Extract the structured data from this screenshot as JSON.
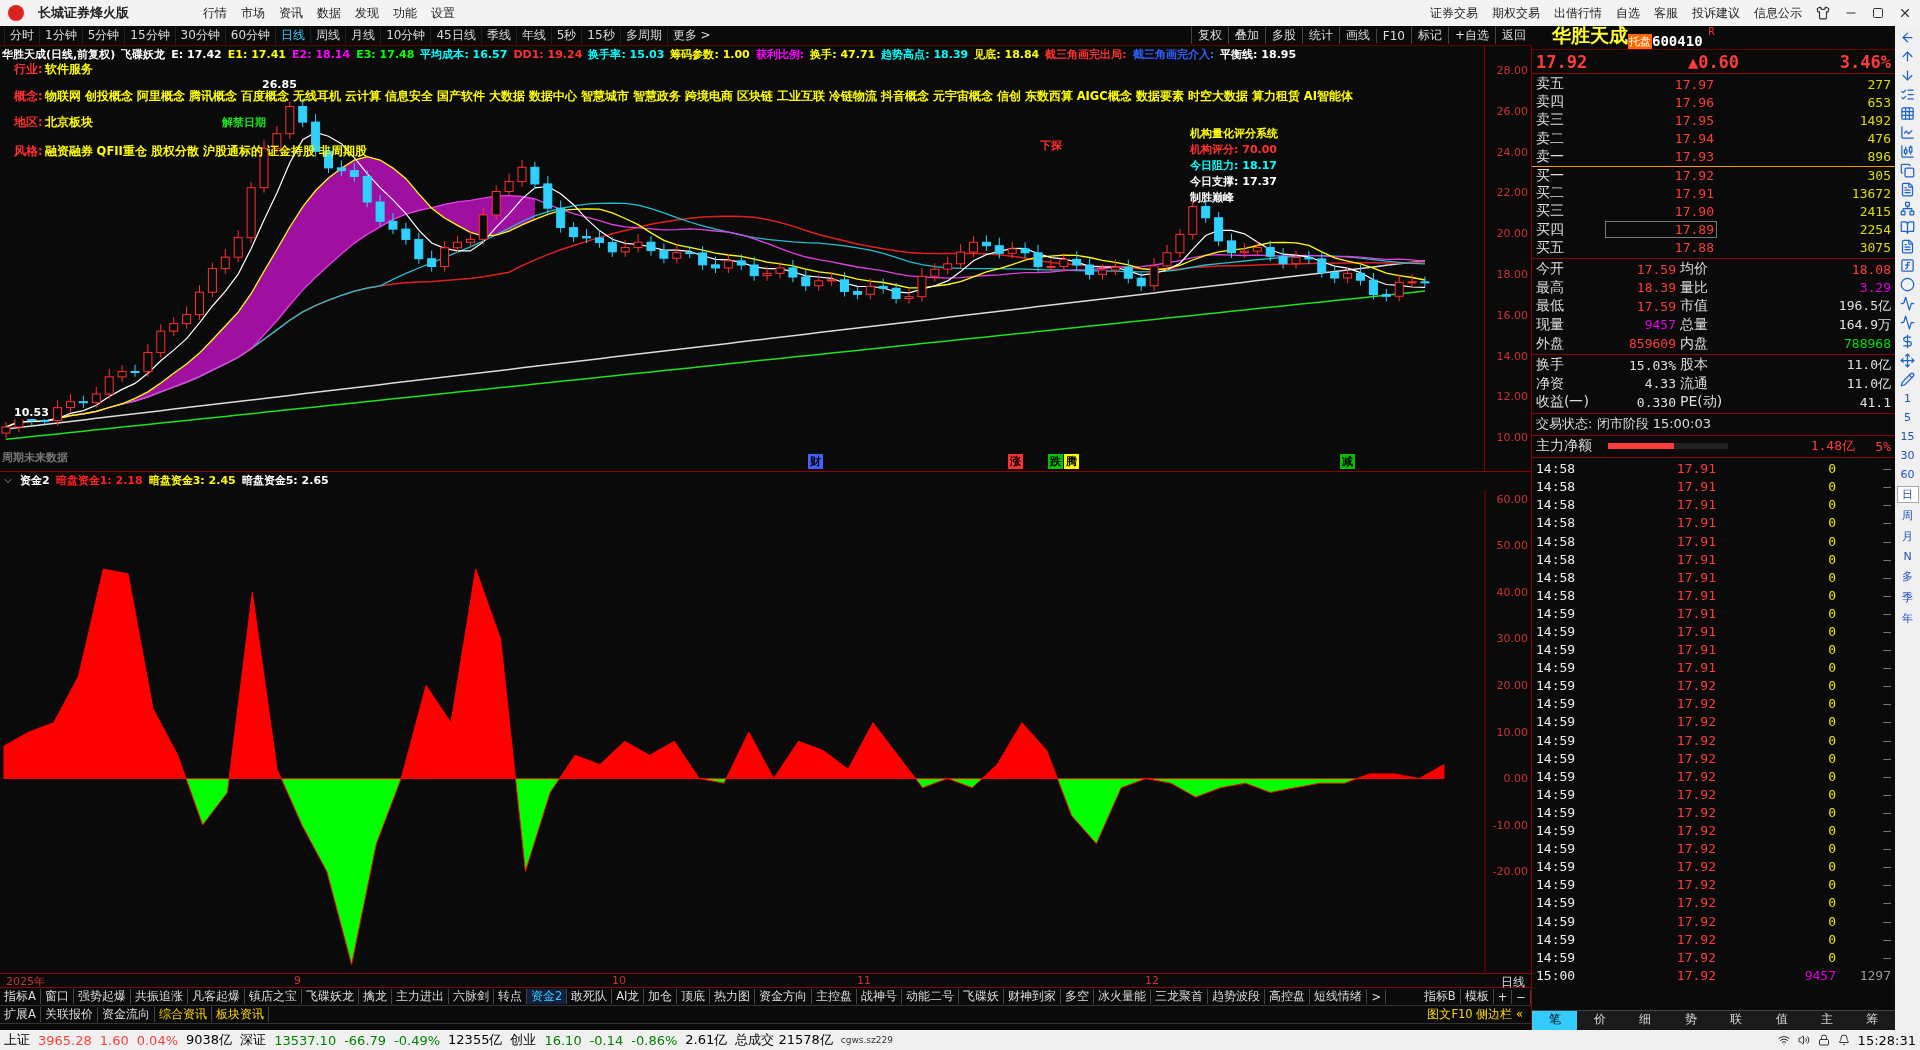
{
  "app": {
    "title": "长城证券烽火版",
    "menu": [
      "行情",
      "市场",
      "资讯",
      "数据",
      "发现",
      "功能",
      "设置"
    ],
    "links": [
      "证券交易",
      "期权交易",
      "出借行情",
      "自选",
      "客服",
      "投诉建议",
      "信息公示"
    ]
  },
  "periods": [
    {
      "label": "分时",
      "selected": false
    },
    {
      "label": "1分钟",
      "selected": false
    },
    {
      "label": "5分钟",
      "selected": false
    },
    {
      "label": "15分钟",
      "selected": false
    },
    {
      "label": "30分钟",
      "selected": false
    },
    {
      "label": "60分钟",
      "selected": false
    },
    {
      "label": "日线",
      "selected": true
    },
    {
      "label": "周线",
      "selected": false
    },
    {
      "label": "月线",
      "selected": false
    },
    {
      "label": "10分钟",
      "selected": false
    },
    {
      "label": "45日线",
      "selected": false
    },
    {
      "label": "季线",
      "selected": false
    },
    {
      "label": "年线",
      "selected": false
    },
    {
      "label": "5秒",
      "selected": false
    },
    {
      "label": "15秒",
      "selected": false
    },
    {
      "label": "多周期",
      "selected": false
    },
    {
      "label": "更多 >",
      "selected": false
    }
  ],
  "chart_tools": [
    "复权",
    "叠加",
    "多股",
    "统计",
    "画线",
    "F10",
    "标记",
    "+自选",
    "返回"
  ],
  "legend": [
    {
      "text": "华胜天成(日线,前复权)",
      "color": "#ffffff"
    },
    {
      "text": "飞碟妖龙",
      "color": "#ffffff"
    },
    {
      "text": "E: 17.42",
      "color": "#ffffff"
    },
    {
      "text": "E1: 17.41",
      "color": "#ffff00"
    },
    {
      "text": "E2: 18.14",
      "color": "#ff00ff"
    },
    {
      "text": "E3: 17.48",
      "color": "#00ff00"
    },
    {
      "text": "平均成本: 16.57",
      "color": "#00ffff"
    },
    {
      "text": "DD1: 19.24",
      "color": "#ff3030"
    },
    {
      "text": "换手率: 15.03",
      "color": "#00ffff"
    },
    {
      "text": "筹码参数: 1.00",
      "color": "#ffff00"
    },
    {
      "text": "获利比例:",
      "color": "#ff00ff"
    },
    {
      "text": "换手: 47.71",
      "color": "#ffff00"
    },
    {
      "text": "趋势高点: 18.39",
      "color": "#00ffff"
    },
    {
      "text": "见底: 18.84",
      "color": "#ffff00"
    },
    {
      "text": "截三角画完出局:",
      "color": "#ff3030"
    },
    {
      "text": "截三角画完介入:",
      "color": "#3060ff"
    },
    {
      "text": "平衡线: 18.95",
      "color": "#ffffff"
    }
  ],
  "profile": [
    {
      "label": "行业:",
      "value": "软件服务"
    },
    {
      "label": "概念:",
      "value": "物联网 创投概念 阿里概念 腾讯概念 百度概念 无线耳机 云计算 信息安全 国产软件 大数据 数据中心 智慧城市 智慧政务 跨境电商 区块链 工业互联 冷链物流 抖音概念 元宇宙概念 信创 东数西算 AIGC概念 数据要素 时空大数据 算力租赁 AI智能体"
    },
    {
      "label": "地区:",
      "value": "北京板块"
    },
    {
      "label": "风格:",
      "value": "融资融券 QFII重仓 股权分散 沪股通标的 证金持股 非周期股"
    }
  ],
  "chart_notes": {
    "unlock": "解禁日期",
    "high": "26.85",
    "low": "10.53",
    "probe": "下探",
    "future": "周期未来数据"
  },
  "score_box": {
    "title": "机构量化评分系统",
    "lines": [
      {
        "text": "机构评分: 70.00",
        "color": "#ff3030"
      },
      {
        "text": "今日阻力: 18.17",
        "color": "#00ffff"
      },
      {
        "text": "今日支撑: 17.37",
        "color": "#ffffff"
      },
      {
        "text": "制胜巅峰",
        "color": "#ffffff"
      }
    ]
  },
  "event_marks": [
    {
      "text": "财",
      "color": "#4060ff"
    },
    {
      "text": "涨",
      "color": "#ff3030"
    },
    {
      "text": "跌",
      "color": "#00c000"
    },
    {
      "text": "腾",
      "color": "#ffff00"
    },
    {
      "text": "减",
      "color": "#00c000"
    }
  ],
  "price_axis": [
    "28.00",
    "26.00",
    "24.00",
    "22.00",
    "20.00",
    "18.00",
    "16.00",
    "14.00",
    "12.00",
    "10.00"
  ],
  "indicator": {
    "legend": [
      {
        "text": "暗盘资金1: 2.18",
        "color": "#ff2020"
      },
      {
        "text": "暗盘资金3: 2.45",
        "color": "#ffff00"
      },
      {
        "text": "暗盘资金5: 2.65",
        "color": "#ffffff"
      }
    ],
    "chart_data": {
      "type": "area",
      "categories": [
        null,
        null,
        null,
        null,
        null,
        null,
        null,
        null,
        null,
        null,
        null,
        null,
        null,
        null,
        null,
        null,
        null,
        null,
        null,
        null,
        null,
        null,
        null,
        null,
        null,
        null,
        null,
        null,
        null,
        null,
        null,
        null,
        null,
        null,
        null,
        null,
        null,
        null,
        null,
        null,
        null,
        null,
        null,
        null,
        null,
        null,
        null,
        null,
        null,
        null,
        null,
        null,
        null,
        null,
        null,
        null,
        null,
        null,
        null
      ],
      "ylim": [
        -42,
        62
      ],
      "yticks": [
        {
          "value": 60,
          "label": "60.00"
        },
        {
          "value": 50,
          "label": "50.00"
        },
        {
          "value": 40,
          "label": "40.00"
        },
        {
          "value": 30,
          "label": "30.00"
        },
        {
          "value": 20,
          "label": "20.00"
        },
        {
          "value": 10,
          "label": "10.00"
        },
        {
          "value": 0,
          "label": "0.00"
        },
        {
          "value": -10,
          "label": "-10.00"
        },
        {
          "value": -20,
          "label": "-20.00"
        }
      ],
      "series": [
        {
          "name": "资金2",
          "color": "#ff0000",
          "values": [
            7,
            10,
            12,
            22,
            45,
            44,
            15,
            5,
            -10,
            -3,
            40,
            2,
            -10,
            -20,
            -40,
            -14,
            0,
            20,
            12,
            45,
            30,
            -20,
            -3,
            5,
            3,
            8,
            5,
            8,
            0,
            -1,
            10,
            0,
            8,
            6,
            2,
            12,
            5,
            -2,
            0,
            -2,
            3,
            12,
            6,
            -8,
            -14,
            -2,
            0,
            -1,
            -4,
            -2,
            -1,
            -3,
            -2,
            -1,
            -1,
            1,
            1,
            0,
            3
          ]
        }
      ]
    }
  },
  "date_axis": [
    "2025年",
    "9",
    "10",
    "11",
    "12"
  ],
  "period_label": "日线",
  "indicator_tabs": [
    {
      "label": "指标A",
      "selected": false
    },
    {
      "label": "窗口",
      "selected": false
    },
    {
      "label": "强势起爆",
      "selected": false
    },
    {
      "label": "共振追涨",
      "selected": false
    },
    {
      "label": "凡客起爆",
      "selected": false
    },
    {
      "label": "镇店之宝",
      "selected": false
    },
    {
      "label": "飞碟妖龙",
      "selected": false
    },
    {
      "label": "擒龙",
      "selected": false
    },
    {
      "label": "主力进出",
      "selected": false
    },
    {
      "label": "六脉剑",
      "selected": false
    },
    {
      "label": "转点",
      "selected": false
    },
    {
      "label": "资金2",
      "selected": true
    },
    {
      "label": "敢死队",
      "selected": false
    },
    {
      "label": "AI龙",
      "selected": false
    },
    {
      "label": "加仓",
      "selected": false
    },
    {
      "label": "顶底",
      "selected": false
    },
    {
      "label": "热力图",
      "selected": false
    },
    {
      "label": "资金方向",
      "selected": false
    },
    {
      "label": "主控盘",
      "selected": false
    },
    {
      "label": "战神号",
      "selected": false
    },
    {
      "label": "动能二号",
      "selected": false
    },
    {
      "label": "飞碟妖",
      "selected": false
    },
    {
      "label": "财神到家",
      "selected": false
    },
    {
      "label": "多空",
      "selected": false
    },
    {
      "label": "冰火量能",
      "selected": false
    },
    {
      "label": "三龙聚首",
      "selected": false
    },
    {
      "label": "趋势波段",
      "selected": false
    },
    {
      "label": "高控盘",
      "selected": false
    },
    {
      "label": "短线情绪",
      "selected": false
    },
    {
      "label": ">",
      "selected": false
    }
  ],
  "indicator_tools": [
    "指标B",
    "模板",
    "+",
    "−"
  ],
  "info_tabs": [
    {
      "label": "扩展A",
      "selected": false
    },
    {
      "label": "关联报价",
      "selected": false
    },
    {
      "label": "资金流向",
      "selected": false
    },
    {
      "label": "综合资讯",
      "selected": true
    },
    {
      "label": "板块资讯",
      "selected": true
    }
  ],
  "side_link": "图文F10 侧边栏 «",
  "quote": {
    "name": "华胜天成",
    "badge": "托盘",
    "code": "600410",
    "flag": "R",
    "price": "17.92",
    "change": "▲0.60",
    "percent": "3.46%"
  },
  "order_book": [
    {
      "label": "卖五",
      "price": "17.97",
      "volume": "277",
      "selected": false
    },
    {
      "label": "卖四",
      "price": "17.96",
      "volume": "653",
      "selected": false
    },
    {
      "label": "卖三",
      "price": "17.95",
      "volume": "1492",
      "selected": false
    },
    {
      "label": "卖二",
      "price": "17.94",
      "volume": "476",
      "selected": false
    },
    {
      "label": "卖一",
      "price": "17.93",
      "volume": "896",
      "selected": false
    },
    {
      "label": "买一",
      "price": "17.92",
      "volume": "305",
      "selected": false
    },
    {
      "label": "买二",
      "price": "17.91",
      "volume": "13672",
      "selected": false
    },
    {
      "label": "买三",
      "price": "17.90",
      "volume": "2415",
      "selected": false
    },
    {
      "label": "买四",
      "price": "17.89",
      "volume": "2254",
      "selected": true
    },
    {
      "label": "买五",
      "price": "17.88",
      "volume": "3075",
      "selected": false
    }
  ],
  "stats": [
    [
      {
        "label": "今开",
        "value": "17.59",
        "color": "#ff3c3c"
      },
      {
        "label": "均价",
        "value": "18.08",
        "color": "#ff3c3c"
      }
    ],
    [
      {
        "label": "最高",
        "value": "18.39",
        "color": "#ff3c3c"
      },
      {
        "label": "量比",
        "value": "3.29",
        "color": "#e000e0"
      }
    ],
    [
      {
        "label": "最低",
        "value": "17.59",
        "color": "#ff3c3c"
      },
      {
        "label": "市值",
        "value": "196.5亿",
        "color": "#e0e0e0"
      }
    ],
    [
      {
        "label": "现量",
        "value": "9457",
        "color": "#e000e0"
      },
      {
        "label": "总量",
        "value": "164.9万",
        "color": "#e0e0e0"
      }
    ],
    [
      {
        "label": "外盘",
        "value": "859609",
        "color": "#ff3c3c"
      },
      {
        "label": "内盘",
        "value": "788968",
        "color": "#00e000"
      }
    ]
  ],
  "fundamentals": [
    [
      {
        "label": "换手",
        "value": "15.03%"
      },
      {
        "label": "股本",
        "value": "11.0亿"
      }
    ],
    [
      {
        "label": "净资",
        "value": "4.33"
      },
      {
        "label": "流通",
        "value": "11.0亿"
      }
    ],
    [
      {
        "label": "收益(一)",
        "value": "0.330"
      },
      {
        "label": "PE(动)",
        "value": "41.1"
      }
    ]
  ],
  "trade_status": "交易状态: 闭市阶段 15:00:03",
  "main_flow": {
    "label": "主力净额",
    "level": 0.55,
    "amount": "1.48亿",
    "percent": "5%"
  },
  "ticks": [
    {
      "time": "14:58",
      "price": "17.91",
      "volume": "0",
      "column_4": "—",
      "kind": "tick"
    },
    {
      "time": "14:58",
      "price": "17.91",
      "volume": "0",
      "column_4": "—",
      "kind": "tick"
    },
    {
      "time": "14:58",
      "price": "17.91",
      "volume": "0",
      "column_4": "—",
      "kind": "tick"
    },
    {
      "time": "14:58",
      "price": "17.91",
      "volume": "0",
      "column_4": "—",
      "kind": "tick"
    },
    {
      "time": "14:58",
      "price": "17.91",
      "volume": "0",
      "column_4": "—",
      "kind": "tick"
    },
    {
      "time": "14:58",
      "price": "17.91",
      "volume": "0",
      "column_4": "—",
      "kind": "tick"
    },
    {
      "time": "14:58",
      "price": "17.91",
      "volume": "0",
      "column_4": "—",
      "kind": "tick"
    },
    {
      "time": "14:58",
      "price": "17.91",
      "volume": "0",
      "column_4": "—",
      "kind": "tick"
    },
    {
      "time": "14:59",
      "price": "17.91",
      "volume": "0",
      "column_4": "—",
      "kind": "tick"
    },
    {
      "time": "14:59",
      "price": "17.91",
      "volume": "0",
      "column_4": "—",
      "kind": "tick"
    },
    {
      "time": "14:59",
      "price": "17.91",
      "volume": "0",
      "column_4": "—",
      "kind": "tick"
    },
    {
      "time": "14:59",
      "price": "17.91",
      "volume": "0",
      "column_4": "—",
      "kind": "tick"
    },
    {
      "time": "14:59",
      "price": "17.92",
      "volume": "0",
      "column_4": "—",
      "kind": "tick"
    },
    {
      "time": "14:59",
      "price": "17.92",
      "volume": "0",
      "column_4": "—",
      "kind": "tick"
    },
    {
      "time": "14:59",
      "price": "17.92",
      "volume": "0",
      "column_4": "—",
      "kind": "tick"
    },
    {
      "time": "14:59",
      "price": "17.92",
      "volume": "0",
      "column_4": "—",
      "kind": "tick"
    },
    {
      "time": "14:59",
      "price": "17.92",
      "volume": "0",
      "column_4": "—",
      "kind": "tick"
    },
    {
      "time": "14:59",
      "price": "17.92",
      "volume": "0",
      "column_4": "—",
      "kind": "tick"
    },
    {
      "time": "14:59",
      "price": "17.92",
      "volume": "0",
      "column_4": "—",
      "kind": "tick"
    },
    {
      "time": "14:59",
      "price": "17.92",
      "volume": "0",
      "column_4": "—",
      "kind": "tick"
    },
    {
      "time": "14:59",
      "price": "17.92",
      "volume": "0",
      "column_4": "—",
      "kind": "tick"
    },
    {
      "time": "14:59",
      "price": "17.92",
      "volume": "0",
      "column_4": "—",
      "kind": "tick"
    },
    {
      "time": "14:59",
      "price": "17.92",
      "volume": "0",
      "column_4": "—",
      "kind": "tick"
    },
    {
      "time": "14:59",
      "price": "17.92",
      "volume": "0",
      "column_4": "—",
      "kind": "tick"
    },
    {
      "time": "14:59",
      "price": "17.92",
      "volume": "0",
      "column_4": "—",
      "kind": "tick"
    },
    {
      "time": "14:59",
      "price": "17.92",
      "volume": "0",
      "column_4": "—",
      "kind": "tick"
    },
    {
      "time": "14:59",
      "price": "17.92",
      "volume": "0",
      "column_4": "—",
      "kind": "tick"
    },
    {
      "time": "14:59",
      "price": "17.92",
      "volume": "0",
      "column_4": "—",
      "kind": "tick"
    },
    {
      "time": "15:00",
      "price": "17.92",
      "volume": "9457",
      "column_4": "1297",
      "kind": "close"
    }
  ],
  "quote_tabs": [
    {
      "label": "笔",
      "selected": true
    },
    {
      "label": "价",
      "selected": false
    },
    {
      "label": "细",
      "selected": false
    },
    {
      "label": "势",
      "selected": false
    },
    {
      "label": "联",
      "selected": false
    },
    {
      "label": "值",
      "selected": false
    },
    {
      "label": "主",
      "selected": false
    },
    {
      "label": "筹",
      "selected": false
    }
  ],
  "side_periods": [
    {
      "label": "1",
      "selected": false
    },
    {
      "label": "5",
      "selected": false
    },
    {
      "label": "15",
      "selected": false
    },
    {
      "label": "30",
      "selected": false
    },
    {
      "label": "60",
      "selected": false
    },
    {
      "label": "日",
      "selected": true
    },
    {
      "label": "周",
      "selected": false
    },
    {
      "label": "月",
      "selected": false
    },
    {
      "label": "N",
      "selected": false
    },
    {
      "label": "多",
      "selected": false
    },
    {
      "label": "季",
      "selected": false
    },
    {
      "label": "年",
      "selected": false
    }
  ],
  "status_bar": {
    "indices": [
      {
        "name": "上证",
        "values": [
          {
            "text": "3965.28",
            "color": "#ff3c3c"
          },
          {
            "text": "1.60",
            "color": "#ff3c3c"
          },
          {
            "text": "0.04%",
            "color": "#ff3c3c"
          },
          {
            "text": "9038亿",
            "color": "#000000"
          }
        ]
      },
      {
        "name": "深证",
        "values": [
          {
            "text": "13537.10",
            "color": "#008000"
          },
          {
            "text": "-66.79",
            "color": "#008000"
          },
          {
            "text": "-0.49%",
            "color": "#008000"
          },
          {
            "text": "12355亿",
            "color": "#000000"
          }
        ]
      },
      {
        "name": "创业",
        "values": [
          {
            "text": "16.10",
            "color": "#008000"
          },
          {
            "text": "-0.14",
            "color": "#008000"
          },
          {
            "text": "-0.86%",
            "color": "#008000"
          },
          {
            "text": "2.61亿",
            "color": "#000000"
          }
        ]
      }
    ],
    "total": "总成交 21578亿",
    "server": "cgws.sz229",
    "clock": "15:28:31"
  }
}
